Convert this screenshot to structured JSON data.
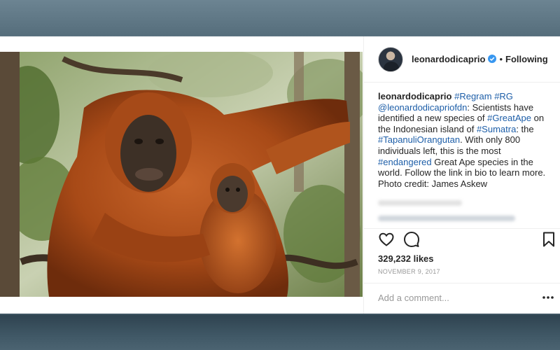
{
  "post": {
    "author": "leonardodicaprio",
    "verified": true,
    "follow_status": "Following",
    "separator": "•",
    "photo": {
      "icon": "orangutan-photo",
      "colors": {
        "fur": "#b5521c",
        "fur_dark": "#7e3412",
        "face": "#3d3026",
        "foliage": "#6f8d4e"
      }
    },
    "caption": {
      "username": "leonardodicaprio",
      "segments": [
        {
          "text": "#Regram",
          "tag": true
        },
        {
          "text": " ",
          "tag": false
        },
        {
          "text": "#RG",
          "tag": true
        },
        {
          "text": " ",
          "tag": false
        },
        {
          "text": "@leonardodicapriofdn",
          "tag": true
        },
        {
          "text": ": Scientists have identified a new species of ",
          "tag": false
        },
        {
          "text": "#GreatApe",
          "tag": true
        },
        {
          "text": " on the Indonesian island of ",
          "tag": false
        },
        {
          "text": "#Sumatra",
          "tag": true
        },
        {
          "text": ": the ",
          "tag": false
        },
        {
          "text": "#TapanuliOrangutan",
          "tag": true
        },
        {
          "text": ". With only 800 individuals left, this is the most ",
          "tag": false
        },
        {
          "text": "#endangered",
          "tag": true
        },
        {
          "text": " Great Ape species in the world. Follow the link in bio to learn more. Photo credit: James Askew",
          "tag": false
        }
      ]
    },
    "actions": {
      "like_icon": "heart-icon",
      "comment_icon": "comment-icon",
      "save_icon": "bookmark-icon",
      "more_icon": "more-options-icon"
    },
    "likes": "329,232 likes",
    "date": "NOVEMBER 9, 2017",
    "comment_placeholder": "Add a comment...",
    "accent_color": "#1d5ea8",
    "verified_color": "#3897f0"
  }
}
